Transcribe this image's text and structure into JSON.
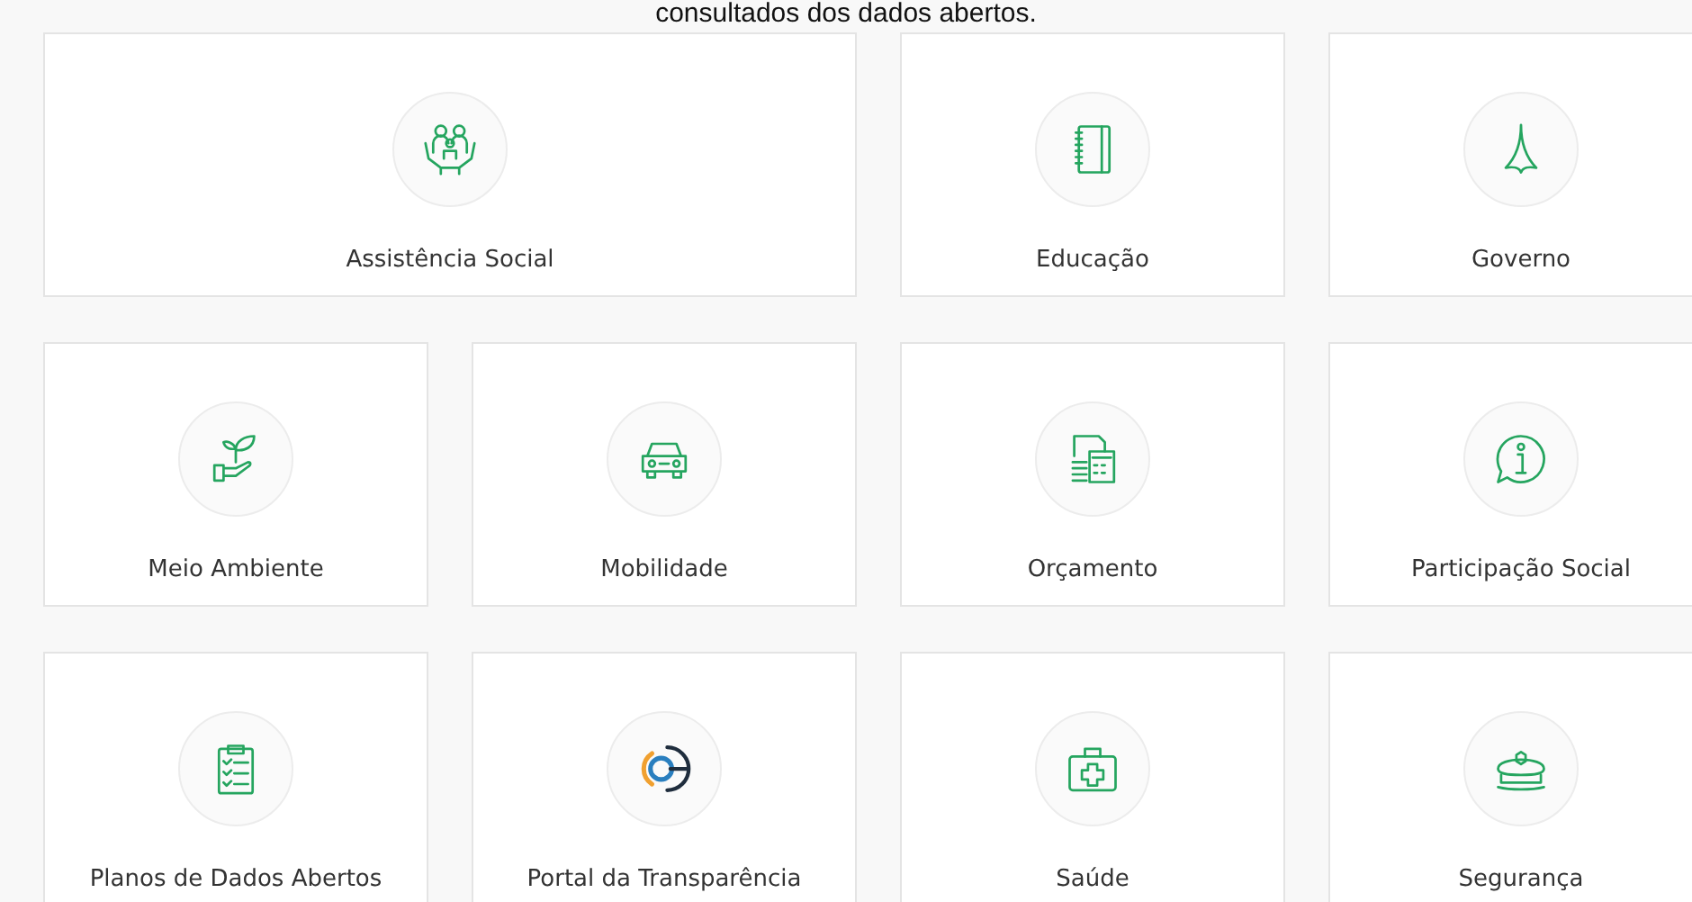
{
  "intro_text": "consultados dos dados abertos.",
  "categories": [
    {
      "label": "Assistência Social",
      "kind": "family",
      "wide": true
    },
    {
      "label": "Educação",
      "kind": "notebook",
      "wide": false
    },
    {
      "label": "Governo",
      "kind": "spire",
      "wide": false
    },
    {
      "label": "Meio Ambiente",
      "kind": "plant",
      "wide": false
    },
    {
      "label": "Mobilidade",
      "kind": "car",
      "wide": false
    },
    {
      "label": "Orçamento",
      "kind": "budget",
      "wide": false
    },
    {
      "label": "Participação Social",
      "kind": "info",
      "wide": false
    },
    {
      "label": "Planos de Dados Abertos",
      "kind": "checklist",
      "wide": false
    },
    {
      "label": "Portal da Transparência",
      "kind": "target",
      "wide": false
    },
    {
      "label": "Saúde",
      "kind": "medkit",
      "wide": false
    },
    {
      "label": "Segurança",
      "kind": "cap",
      "wide": false
    }
  ]
}
